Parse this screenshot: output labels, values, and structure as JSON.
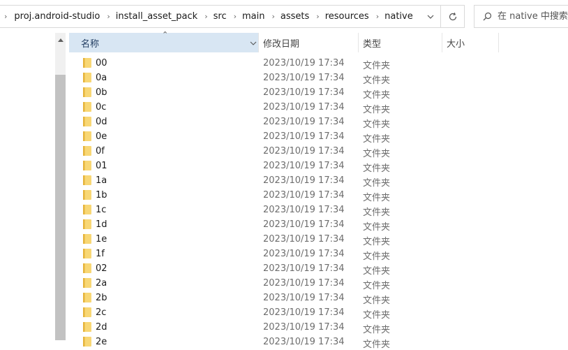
{
  "breadcrumb": {
    "items": [
      "proj.android-studio",
      "install_asset_pack",
      "src",
      "main",
      "assets",
      "resources",
      "native"
    ]
  },
  "search": {
    "placeholder": "在 native 中搜索"
  },
  "columns": {
    "name": "名称",
    "date": "修改日期",
    "type": "类型",
    "size": "大小"
  },
  "rows": [
    {
      "name": "00",
      "date": "2023/10/19 17:34",
      "type": "文件夹"
    },
    {
      "name": "0a",
      "date": "2023/10/19 17:34",
      "type": "文件夹"
    },
    {
      "name": "0b",
      "date": "2023/10/19 17:34",
      "type": "文件夹"
    },
    {
      "name": "0c",
      "date": "2023/10/19 17:34",
      "type": "文件夹"
    },
    {
      "name": "0d",
      "date": "2023/10/19 17:34",
      "type": "文件夹"
    },
    {
      "name": "0e",
      "date": "2023/10/19 17:34",
      "type": "文件夹"
    },
    {
      "name": "0f",
      "date": "2023/10/19 17:34",
      "type": "文件夹"
    },
    {
      "name": "01",
      "date": "2023/10/19 17:34",
      "type": "文件夹"
    },
    {
      "name": "1a",
      "date": "2023/10/19 17:34",
      "type": "文件夹"
    },
    {
      "name": "1b",
      "date": "2023/10/19 17:34",
      "type": "文件夹"
    },
    {
      "name": "1c",
      "date": "2023/10/19 17:34",
      "type": "文件夹"
    },
    {
      "name": "1d",
      "date": "2023/10/19 17:34",
      "type": "文件夹"
    },
    {
      "name": "1e",
      "date": "2023/10/19 17:34",
      "type": "文件夹"
    },
    {
      "name": "1f",
      "date": "2023/10/19 17:34",
      "type": "文件夹"
    },
    {
      "name": "02",
      "date": "2023/10/19 17:34",
      "type": "文件夹"
    },
    {
      "name": "2a",
      "date": "2023/10/19 17:34",
      "type": "文件夹"
    },
    {
      "name": "2b",
      "date": "2023/10/19 17:34",
      "type": "文件夹"
    },
    {
      "name": "2c",
      "date": "2023/10/19 17:34",
      "type": "文件夹"
    },
    {
      "name": "2d",
      "date": "2023/10/19 17:34",
      "type": "文件夹"
    },
    {
      "name": "2e",
      "date": "2023/10/19 17:34",
      "type": "文件夹"
    }
  ],
  "colors": {
    "folder": "#f8d775",
    "folder_dark": "#e6b43c",
    "header_selected": "#d8e6f3",
    "scroll_thumb": "#c2c2c2"
  }
}
